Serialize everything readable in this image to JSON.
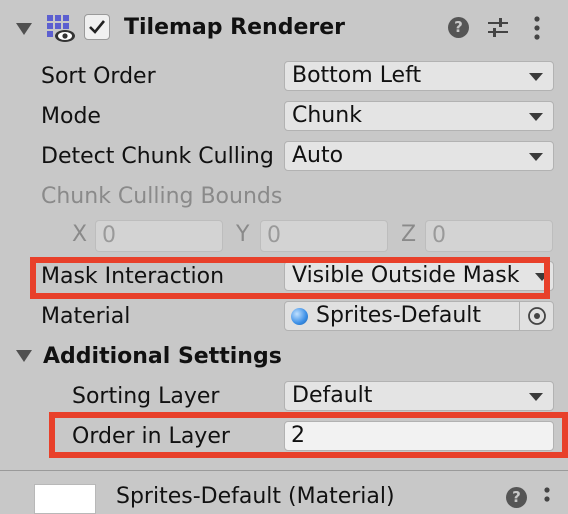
{
  "component": {
    "title": "Tilemap Renderer",
    "enabled": true
  },
  "properties": {
    "sort_order": {
      "label": "Sort Order",
      "value": "Bottom Left"
    },
    "mode": {
      "label": "Mode",
      "value": "Chunk"
    },
    "detect_chunk_culling": {
      "label": "Detect Chunk Culling",
      "value": "Auto"
    },
    "chunk_culling_bounds": {
      "label": "Chunk Culling Bounds",
      "x_label": "X",
      "x_value": "0",
      "y_label": "Y",
      "y_value": "0",
      "z_label": "Z",
      "z_value": "0"
    },
    "mask_interaction": {
      "label": "Mask Interaction",
      "value": "Visible Outside Mask"
    },
    "material": {
      "label": "Material",
      "value": "Sprites-Default"
    }
  },
  "additional_settings": {
    "header": "Additional Settings",
    "sorting_layer": {
      "label": "Sorting Layer",
      "value": "Default"
    },
    "order_in_layer": {
      "label": "Order in Layer",
      "value": "2"
    }
  },
  "material_panel": {
    "title": "Sprites-Default (Material)"
  },
  "colors": {
    "panel_bg": "#c8c8c8",
    "highlight": "#e8402a",
    "material_dot": "#3a8ee6"
  }
}
